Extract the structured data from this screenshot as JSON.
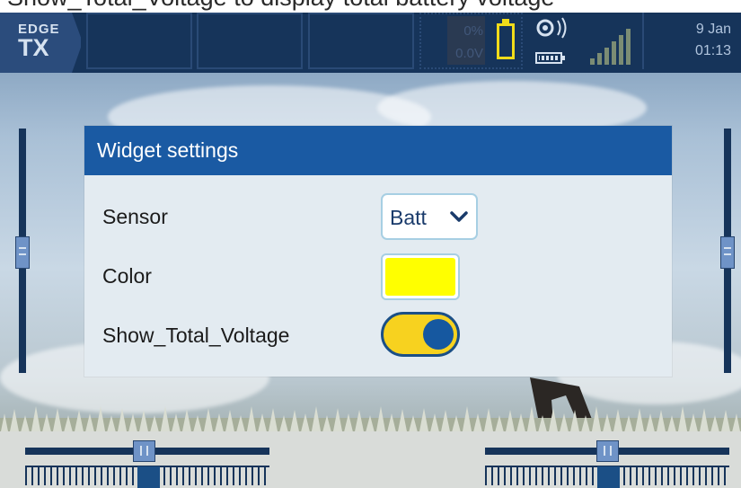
{
  "caption": {
    "text": "Show_Total_Voltage to display total battery voltage"
  },
  "topbar": {
    "logo_line1": "EDGE",
    "logo_line2": "TX",
    "battery_percent": "0%",
    "voltage": "0.0V",
    "date": "9 Jan",
    "time": "01:13",
    "icons": [
      "battery-icon",
      "radio-icon",
      "tx-battery-icon",
      "signal-strength-icon"
    ]
  },
  "dialog": {
    "title": "Widget settings",
    "rows": [
      {
        "label": "Sensor",
        "value": "Batt"
      },
      {
        "label": "Color",
        "color": "#ffff00"
      },
      {
        "label": "Show_Total_Voltage",
        "enabled": true
      }
    ]
  },
  "colors": {
    "header_bg": "#1a5aa3",
    "topbar_bg": "#16345a",
    "battery_outline": "#f1dc1a",
    "toggle_on": "#f7d21f"
  }
}
